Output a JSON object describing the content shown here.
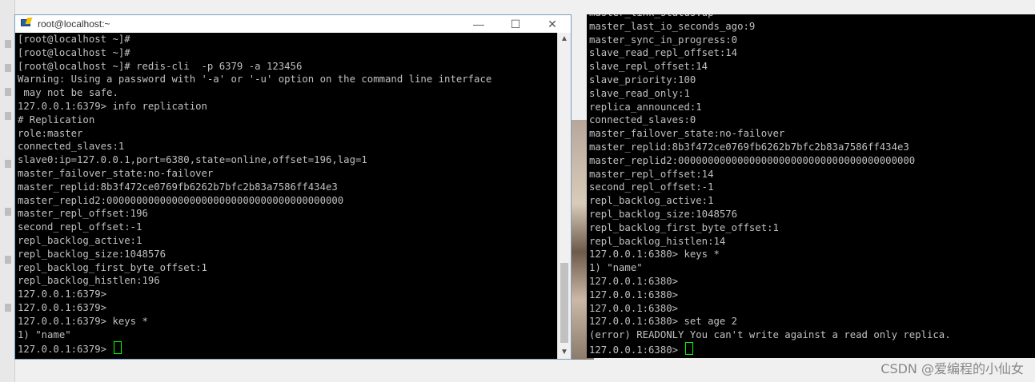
{
  "left_window": {
    "title": "root@localhost:~",
    "buttons": {
      "minimize": "—",
      "maximize": "☐",
      "close": "✕"
    },
    "terminal_lines": [
      "[root@localhost ~]#",
      "[root@localhost ~]#",
      "[root@localhost ~]# redis-cli  -p 6379 -a 123456",
      "Warning: Using a password with '-a' or '-u' option on the command line interface",
      " may not be safe.",
      "127.0.0.1:6379> info replication",
      "# Replication",
      "role:master",
      "connected_slaves:1",
      "slave0:ip=127.0.0.1,port=6380,state=online,offset=196,lag=1",
      "master_failover_state:no-failover",
      "master_replid:8b3f472ce0769fb6262b7bfc2b83a7586ff434e3",
      "master_replid2:0000000000000000000000000000000000000000",
      "master_repl_offset:196",
      "second_repl_offset:-1",
      "repl_backlog_active:1",
      "repl_backlog_size:1048576",
      "repl_backlog_first_byte_offset:1",
      "repl_backlog_histlen:196",
      "127.0.0.1:6379>",
      "127.0.0.1:6379>",
      "127.0.0.1:6379> keys *",
      "1) \"name\"",
      "127.0.0.1:6379> "
    ]
  },
  "right_terminal": {
    "lines": [
      "master_link_status:up",
      "master_last_io_seconds_ago:9",
      "master_sync_in_progress:0",
      "slave_read_repl_offset:14",
      "slave_repl_offset:14",
      "slave_priority:100",
      "slave_read_only:1",
      "replica_announced:1",
      "connected_slaves:0",
      "master_failover_state:no-failover",
      "master_replid:8b3f472ce0769fb6262b7bfc2b83a7586ff434e3",
      "master_replid2:0000000000000000000000000000000000000000",
      "master_repl_offset:14",
      "second_repl_offset:-1",
      "repl_backlog_active:1",
      "repl_backlog_size:1048576",
      "repl_backlog_first_byte_offset:1",
      "repl_backlog_histlen:14",
      "127.0.0.1:6380> keys *",
      "1) \"name\"",
      "127.0.0.1:6380>",
      "127.0.0.1:6380>",
      "127.0.0.1:6380>",
      "127.0.0.1:6380> set age 2",
      "(error) READONLY You can't write against a read only replica.",
      "127.0.0.1:6380> "
    ]
  },
  "watermark": "CSDN @爱编程的小仙女",
  "colors": {
    "terminal_bg": "#000000",
    "terminal_fg": "#c0c0c0",
    "cursor": "#00ff00"
  }
}
